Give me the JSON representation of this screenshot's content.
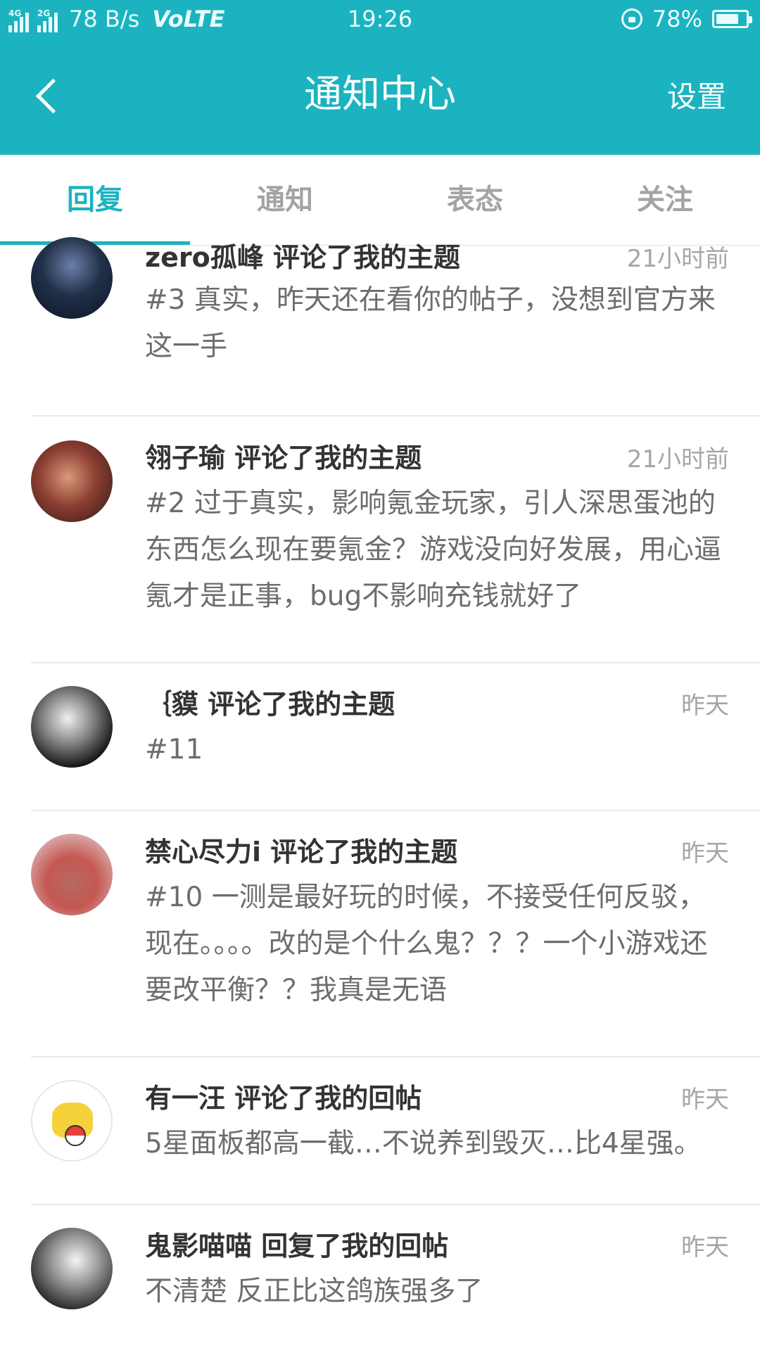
{
  "status_bar": {
    "network_top": "4G",
    "network_2": "2G",
    "speed": "78 B/s",
    "volte": "VoLTE",
    "time": "19:26",
    "battery": "78%",
    "battery_level": 0.78
  },
  "header": {
    "title": "通知中心",
    "settings": "设置",
    "back_icon": "chevron-left-icon",
    "color": "#1bb3c0"
  },
  "tabs": [
    {
      "label": "回复",
      "active": true
    },
    {
      "label": "通知",
      "active": false
    },
    {
      "label": "表态",
      "active": false
    },
    {
      "label": "关注",
      "active": false
    }
  ],
  "notifications": [
    {
      "user_action": "zero孤峰 评论了我的主题",
      "time": "21小时前",
      "message": "#3 真实，昨天还在看你的帖子，没想到官方来这一手"
    },
    {
      "user_action": "翎子瑜 评论了我的主题",
      "time": "21小时前",
      "message": "#2 过于真实，影响氪金玩家，引人深思蛋池的东西怎么现在要氪金？游戏没向好发展，用心逼氪才是正事，bug不影响充钱就好了"
    },
    {
      "user_action": "｛貘 评论了我的主题",
      "time": "昨天",
      "message": "#11"
    },
    {
      "user_action": "禁心尽力i 评论了我的主题",
      "time": "昨天",
      "message": "#10 一测是最好玩的时候，不接受任何反驳，现在。。。。改的是个什么鬼？？？一个小游戏还要改平衡？？我真是无语"
    },
    {
      "user_action": "有一汪 评论了我的回帖",
      "time": "昨天",
      "message": "5星面板都高一截…不说养到毁灭…比4星强。"
    },
    {
      "user_action": "鬼影喵喵 回复了我的回帖",
      "time": "昨天",
      "message": "不清楚 反正比这鸽族强多了"
    }
  ]
}
